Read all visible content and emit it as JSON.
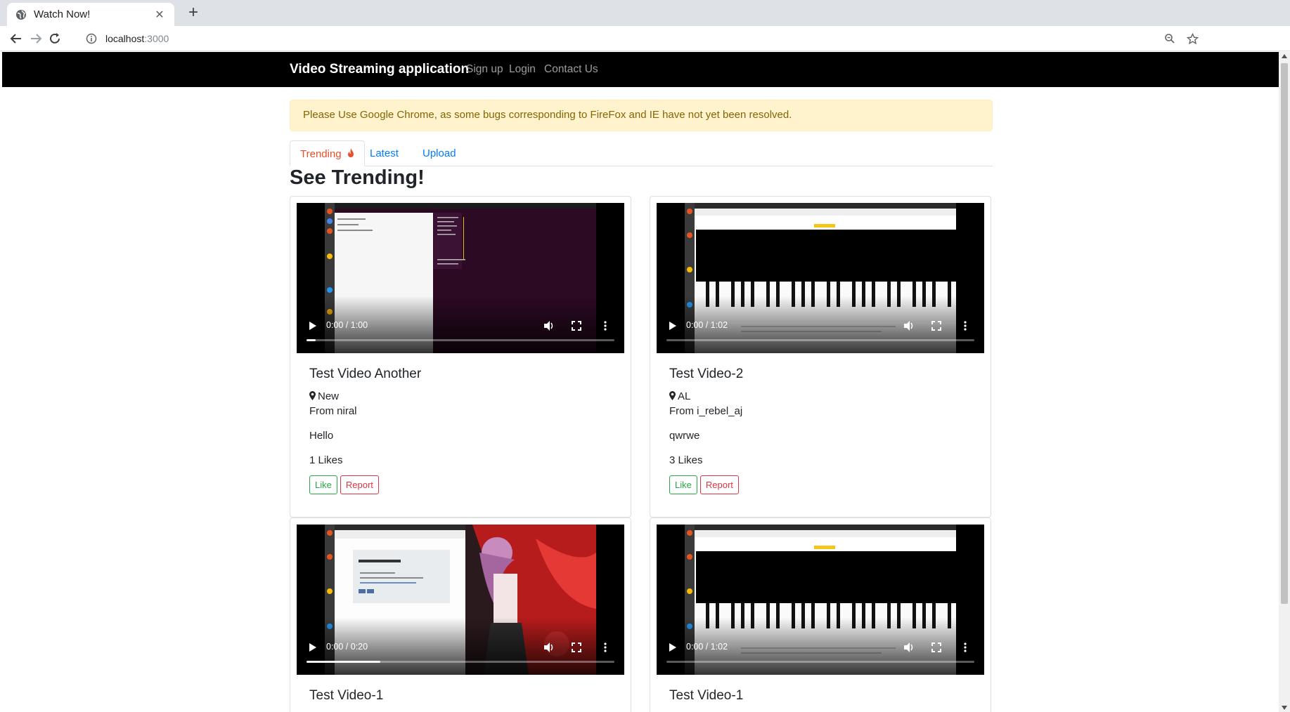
{
  "browser": {
    "tab_title": "Watch Now!",
    "url_host": "localhost",
    "url_port": ":3000"
  },
  "navbar": {
    "brand": "Video Streaming application",
    "links": [
      "Sign up",
      "Login",
      "Contact Us"
    ]
  },
  "alert": {
    "text": "Please Use Google Chrome, as some bugs corresponding to FireFox and IE have not yet been resolved."
  },
  "tabs": [
    {
      "label": "Trending"
    },
    {
      "label": "Latest"
    },
    {
      "label": "Upload"
    }
  ],
  "heading": "See Trending!",
  "videos": [
    {
      "title": "Test Video Another",
      "location": "New",
      "from": "From niral",
      "description": "Hello",
      "likes": "1 Likes",
      "time": "0:00 / 1:00",
      "progress": 0.03,
      "thumbnail": "desktop-terminal"
    },
    {
      "title": "Test Video-2",
      "location": "AL",
      "from": "From i_rebel_aj",
      "description": "qwrwe",
      "likes": "3 Likes",
      "time": "0:00 / 1:02",
      "progress": 0.0,
      "thumbnail": "piano-app"
    },
    {
      "title": "Test Video-1",
      "time": "0:00 / 0:20",
      "progress": 0.24,
      "thumbnail": "chat-app-anime"
    },
    {
      "title": "Test Video-1",
      "time": "0:00 / 1:02",
      "progress": 0.0,
      "thumbnail": "piano-app"
    }
  ],
  "buttons": {
    "like": "Like",
    "report": "Report"
  },
  "colors": {
    "navbar": "#000000",
    "alert_bg": "#fff3cd",
    "active_tab": "#e8502a",
    "link": "#007bff",
    "like": "#28a745",
    "report": "#dc3545"
  }
}
